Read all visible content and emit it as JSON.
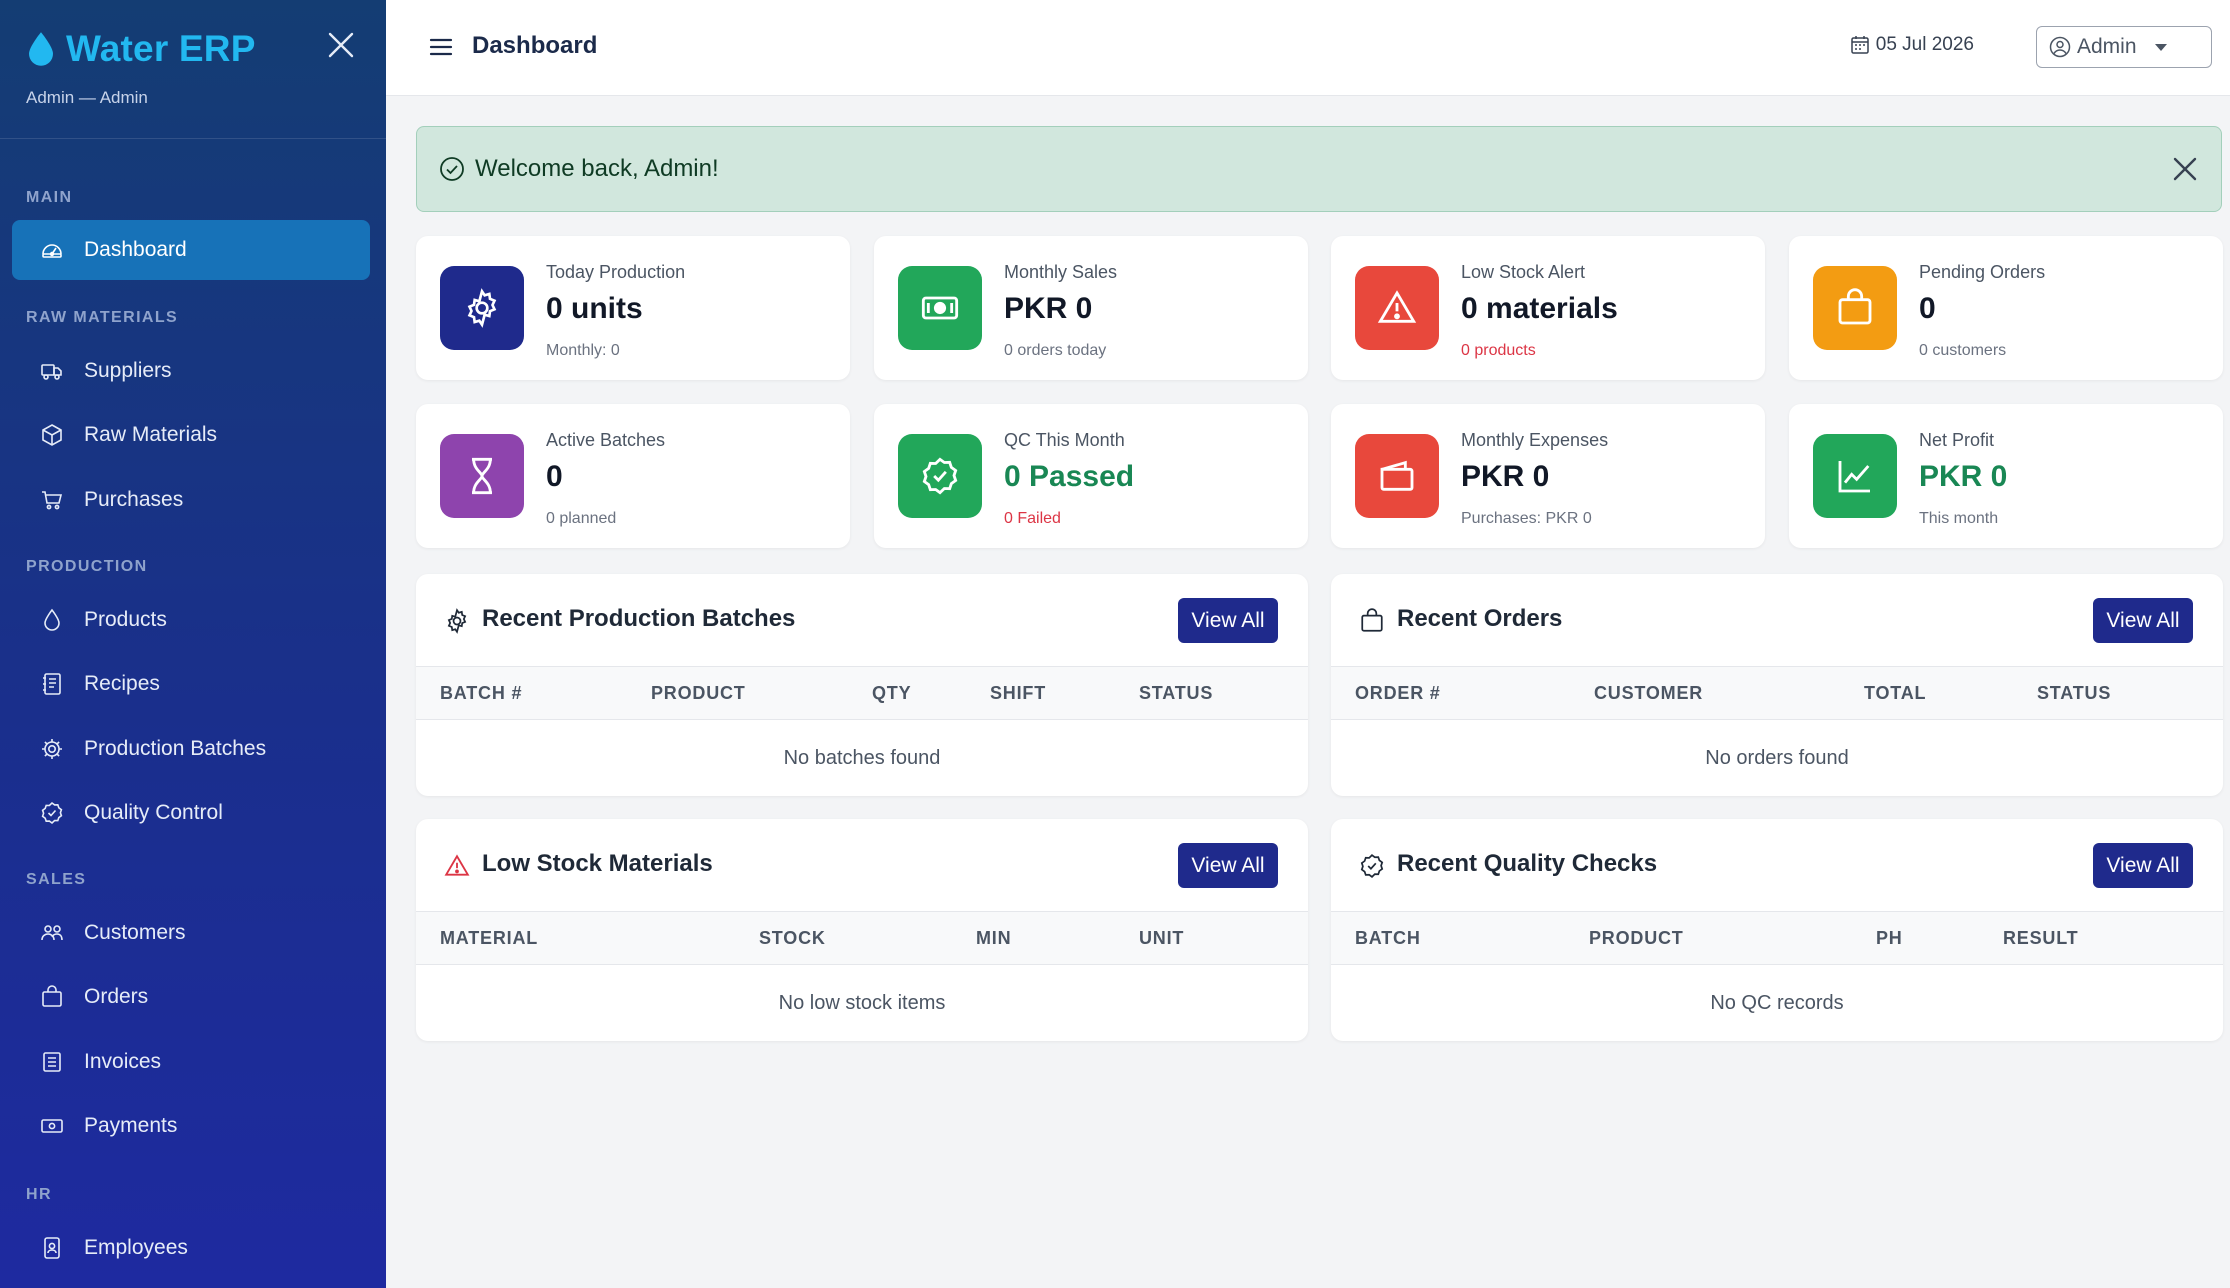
{
  "sidebar": {
    "brand": "Water ERP",
    "subtitle": "Admin — Admin",
    "sections": {
      "main": "MAIN",
      "raw": "RAW MATERIALS",
      "production": "PRODUCTION",
      "sales": "SALES",
      "hr": "HR"
    },
    "items": {
      "dashboard": "Dashboard",
      "suppliers": "Suppliers",
      "raw_materials": "Raw Materials",
      "purchases": "Purchases",
      "products": "Products",
      "recipes": "Recipes",
      "production_batches": "Production Batches",
      "quality_control": "Quality Control",
      "customers": "Customers",
      "orders": "Orders",
      "invoices": "Invoices",
      "payments": "Payments",
      "employees": "Employees"
    }
  },
  "topbar": {
    "title": "Dashboard",
    "date": "05 Jul 2026",
    "user": "Admin"
  },
  "alert": {
    "message": "Welcome back, Admin!"
  },
  "stats": [
    {
      "label": "Today Production",
      "value": "0 units",
      "sub": "Monthly: 0",
      "color": "#1f2a8c",
      "icon": "gear-icon"
    },
    {
      "label": "Monthly Sales",
      "value": "PKR 0",
      "sub": "0 orders today",
      "color": "#22a75a",
      "icon": "cash-icon"
    },
    {
      "label": "Low Stock Alert",
      "value": "0 materials",
      "sub": "0 products",
      "color": "#e8483c",
      "icon": "warning-icon"
    },
    {
      "label": "Pending Orders",
      "value": "0",
      "sub": "0 customers",
      "color": "#f39c12",
      "icon": "bag-icon"
    },
    {
      "label": "Active Batches",
      "value": "0",
      "sub": "0 planned",
      "color": "#8e44ad",
      "icon": "hourglass-icon"
    },
    {
      "label": "QC This Month",
      "value": "0 Passed",
      "sub": "0 Failed",
      "color": "#22a75a",
      "icon": "badge-check-icon"
    },
    {
      "label": "Monthly Expenses",
      "value": "PKR 0",
      "sub": "Purchases: PKR 0",
      "color": "#e8483c",
      "icon": "wallet-icon"
    },
    {
      "label": "Net Profit",
      "value": "PKR 0",
      "sub": "This month",
      "color": "#22a75a",
      "icon": "graph-up-icon"
    }
  ],
  "panels": {
    "batches": {
      "title": "Recent Production Batches",
      "button": "View All",
      "columns": [
        "BATCH #",
        "PRODUCT",
        "QTY",
        "SHIFT",
        "STATUS"
      ],
      "empty": "No batches found"
    },
    "orders": {
      "title": "Recent Orders",
      "button": "View All",
      "columns": [
        "ORDER #",
        "CUSTOMER",
        "TOTAL",
        "STATUS"
      ],
      "empty": "No orders found"
    },
    "low_stock": {
      "title": "Low Stock Materials",
      "button": "View All",
      "columns": [
        "MATERIAL",
        "STOCK",
        "MIN",
        "UNIT"
      ],
      "empty": "No low stock items"
    },
    "qc": {
      "title": "Recent Quality Checks",
      "button": "View All",
      "columns": [
        "BATCH",
        "PRODUCT",
        "PH",
        "RESULT"
      ],
      "empty": "No QC records"
    }
  },
  "colors": {
    "accent": "#1f2a8c",
    "sidebar_active": "#1772b8",
    "brand": "#22b8f0",
    "danger": "#dc3545",
    "success": "#198754"
  }
}
